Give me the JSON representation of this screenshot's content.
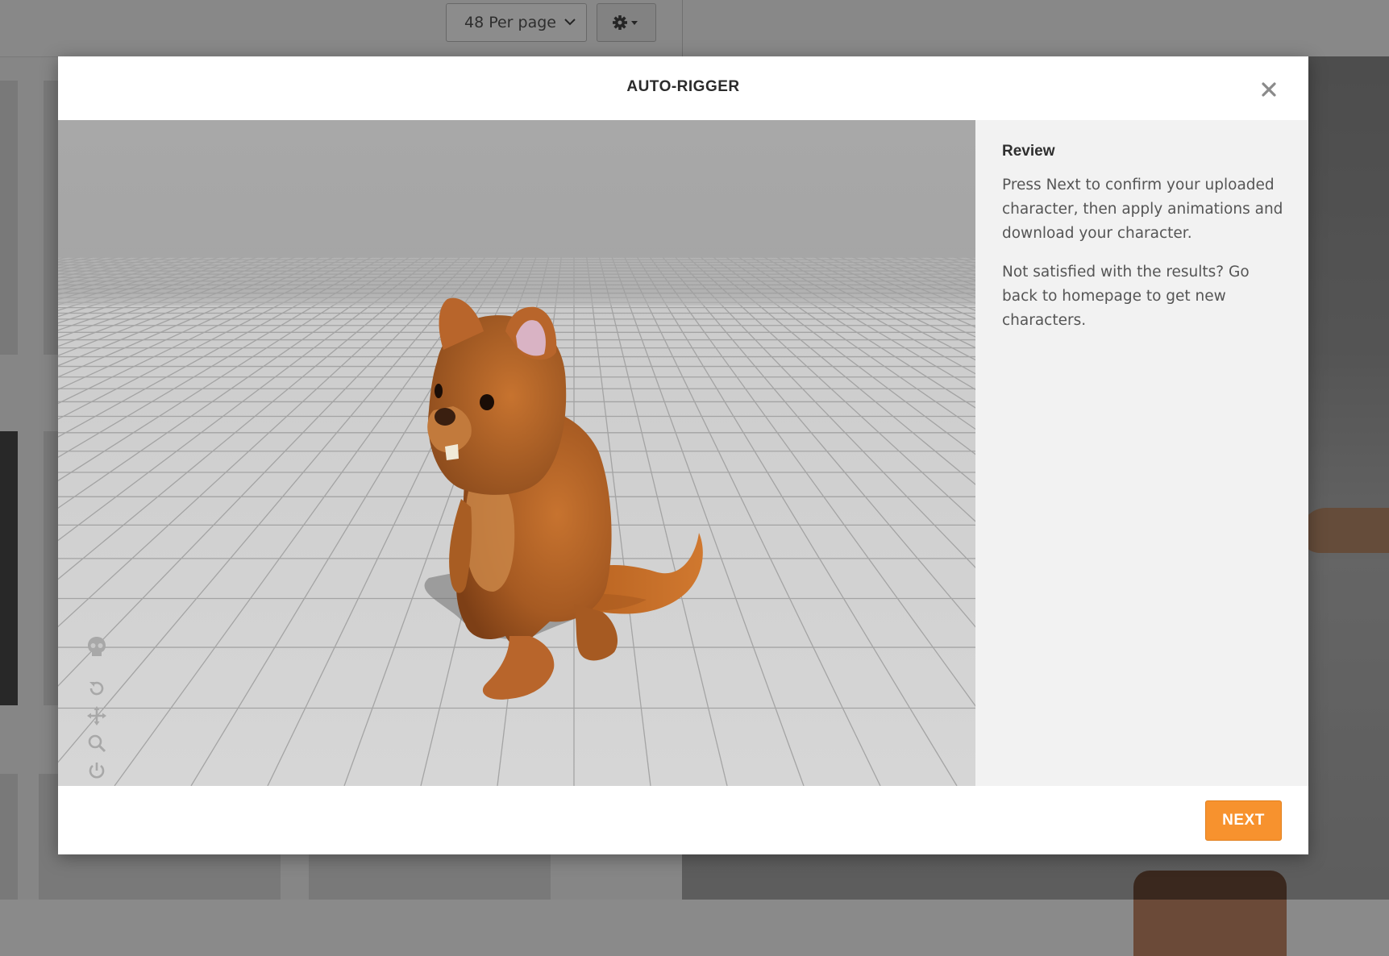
{
  "background": {
    "per_page_select": "48 Per page"
  },
  "modal": {
    "title": "AUTO-RIGGER",
    "close_symbol": "×",
    "side_panel": {
      "heading": "Review",
      "paragraphs": [
        "Press Next to confirm your uploaded character, then apply animations and download your character.",
        "Not satisfied with the results? Go back to homepage to get new characters."
      ]
    },
    "viewer_tools": [
      {
        "icon": "skeleton-icon"
      },
      {
        "icon": "rotate-icon"
      },
      {
        "icon": "move-icon"
      },
      {
        "icon": "zoom-icon"
      },
      {
        "icon": "power-icon"
      },
      {
        "icon": "camera-icon"
      }
    ],
    "footer": {
      "next_label": "NEXT"
    }
  },
  "colors": {
    "accent": "#f7922e",
    "character_body": "#b8652b",
    "viewport_floor": "#d0d0d0"
  }
}
